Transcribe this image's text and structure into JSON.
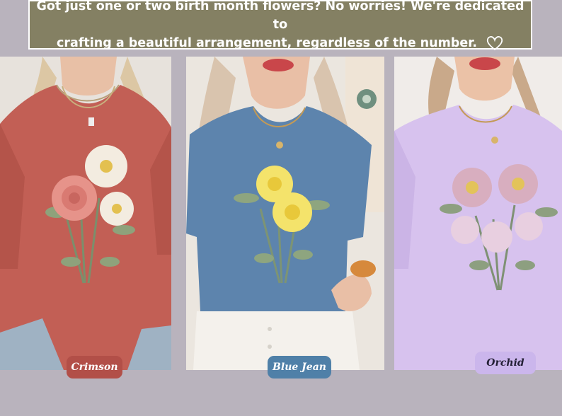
{
  "banner": {
    "line1": "Got just one or two birth month flowers? No worries! We're dedicated to",
    "line2": "crafting a beautiful arrangement, regardless of the number.",
    "icon": "heart-outline-icon"
  },
  "products": [
    {
      "label": "Crimson",
      "color": "#b24f48",
      "shirt_color": "#c25f55",
      "flowers": "rose and daisies"
    },
    {
      "label": "Blue Jean",
      "color": "#4f80a8",
      "shirt_color": "#5d84ad",
      "flowers": "daffodils"
    },
    {
      "label": "Orchid",
      "color": "#cbb6ec",
      "shirt_color": "#d7c2ee",
      "flowers": "asters and lilies"
    }
  ]
}
